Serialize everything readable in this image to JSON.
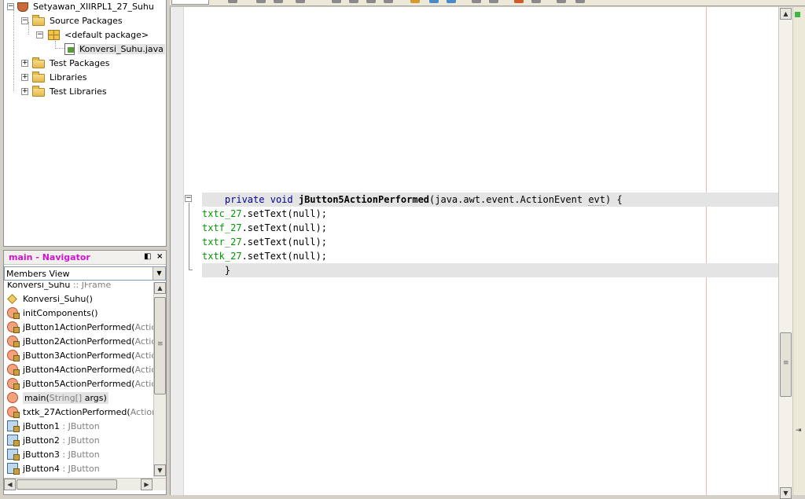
{
  "project_tree": {
    "project": "Setyawan_XIIRPL1_27_Suhu",
    "source_packages": "Source Packages",
    "default_package": "<default package>",
    "file": "Konversi_Suhu.java",
    "test_packages": "Test Packages",
    "libraries": "Libraries",
    "test_libraries": "Test Libraries"
  },
  "navigator": {
    "title": "main - Navigator",
    "view": "Members View",
    "header_item": {
      "name": "Konversi_Suhu",
      "sep": " :: ",
      "type": "JFrame"
    },
    "members": [
      {
        "icon": "constructor-icon",
        "name": "Konversi_Suhu()",
        "detail": ""
      },
      {
        "icon": "private-method-icon",
        "name": "initComponents()",
        "detail": ""
      },
      {
        "icon": "private-method-icon",
        "name": "jButton1ActionPerformed(",
        "detail": "ActionEv"
      },
      {
        "icon": "private-method-icon",
        "name": "jButton2ActionPerformed(",
        "detail": "ActionEv"
      },
      {
        "icon": "private-method-icon",
        "name": "jButton3ActionPerformed(",
        "detail": "ActionEv"
      },
      {
        "icon": "private-method-icon",
        "name": "jButton4ActionPerformed(",
        "detail": "ActionEv"
      },
      {
        "icon": "private-method-icon",
        "name": "jButton5ActionPerformed(",
        "detail": "ActionEv"
      },
      {
        "icon": "public-method-icon",
        "name": "main(",
        "detail": "String[]",
        "tail": " args)"
      },
      {
        "icon": "private-method-icon",
        "name": "txtk_27ActionPerformed(",
        "detail": "ActionEv"
      },
      {
        "icon": "field-icon",
        "name": "jButton1",
        "detail": " : JButton"
      },
      {
        "icon": "field-icon",
        "name": "jButton2",
        "detail": " : JButton"
      },
      {
        "icon": "field-icon",
        "name": "jButton3",
        "detail": " : JButton"
      },
      {
        "icon": "field-icon",
        "name": "jButton4",
        "detail": " : JButton"
      }
    ]
  },
  "editor": {
    "method_header": {
      "indent": "    ",
      "modifier": "private",
      "ret": "void",
      "name": "jButton5ActionPerformed",
      "params_pre": "(java.awt.event.ActionEvent ",
      "param_name": "evt",
      "params_post": ") {"
    },
    "statements": [
      {
        "field": "txtc_27",
        "call": ".setText(null);"
      },
      {
        "field": "txtf_27",
        "call": ".setText(null);"
      },
      {
        "field": "txtr_27",
        "call": ".setText(null);"
      },
      {
        "field": "txtk_27",
        "call": ".setText(null);"
      }
    ],
    "closing": "    }"
  }
}
